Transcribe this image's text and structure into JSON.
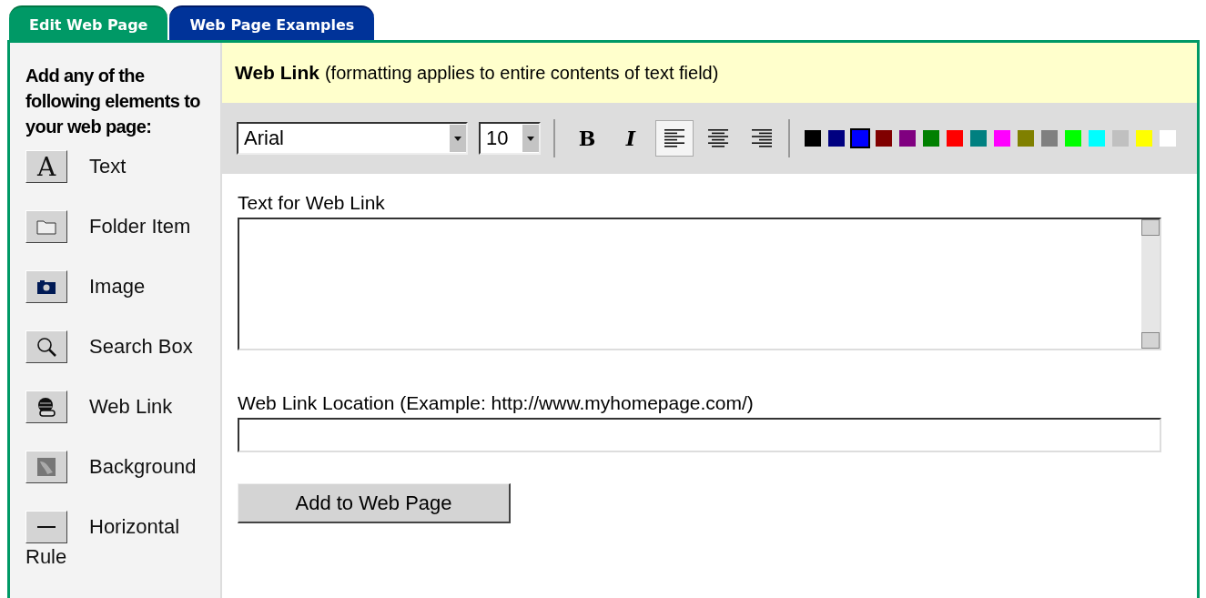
{
  "tabs": [
    {
      "label": "Edit Web Page",
      "selected": true,
      "color": "#009966"
    },
    {
      "label": "Web Page Examples",
      "selected": false,
      "color": "#003399"
    }
  ],
  "sidebar": {
    "heading": "Add any of the following elements to your web page:",
    "items": [
      {
        "kind": "text",
        "label": "Text",
        "glyph": "A"
      },
      {
        "kind": "folder",
        "label": "Folder Item"
      },
      {
        "kind": "image",
        "label": "Image"
      },
      {
        "kind": "search",
        "label": "Search Box"
      },
      {
        "kind": "link",
        "label": "Web Link"
      },
      {
        "kind": "background",
        "label": "Background"
      },
      {
        "kind": "rule",
        "label": "Horizontal",
        "label_wrap": "Rule"
      }
    ]
  },
  "header": {
    "title": "Web Link",
    "note": "(formatting applies to entire contents of text field)"
  },
  "toolbar": {
    "font": "Arial",
    "size": "10",
    "styles": [
      {
        "kind": "bold",
        "glyph": "B"
      },
      {
        "kind": "italic",
        "glyph": "I"
      }
    ],
    "alignments": [
      {
        "kind": "left",
        "selected": true
      },
      {
        "kind": "center",
        "selected": false
      },
      {
        "kind": "right",
        "selected": false
      }
    ],
    "colors": [
      {
        "color": "#000000",
        "selected": false
      },
      {
        "color": "#000080",
        "selected": false
      },
      {
        "color": "#0000ff",
        "selected": true
      },
      {
        "color": "#800000",
        "selected": false
      },
      {
        "color": "#800080",
        "selected": false
      },
      {
        "color": "#008000",
        "selected": false
      },
      {
        "color": "#ff0000",
        "selected": false
      },
      {
        "color": "#008080",
        "selected": false
      },
      {
        "color": "#ff00ff",
        "selected": false
      },
      {
        "color": "#808000",
        "selected": false
      },
      {
        "color": "#808080",
        "selected": false
      },
      {
        "color": "#00ff00",
        "selected": false
      },
      {
        "color": "#00ffff",
        "selected": false
      },
      {
        "color": "#c0c0c0",
        "selected": false
      },
      {
        "color": "#ffff00",
        "selected": false
      },
      {
        "color": "#ffffff",
        "selected": false
      }
    ]
  },
  "form": {
    "text_label": "Text for Web Link",
    "location_label": "Web Link Location (Example: http://www.myhomepage.com/)",
    "button": "Add to Web Page"
  }
}
